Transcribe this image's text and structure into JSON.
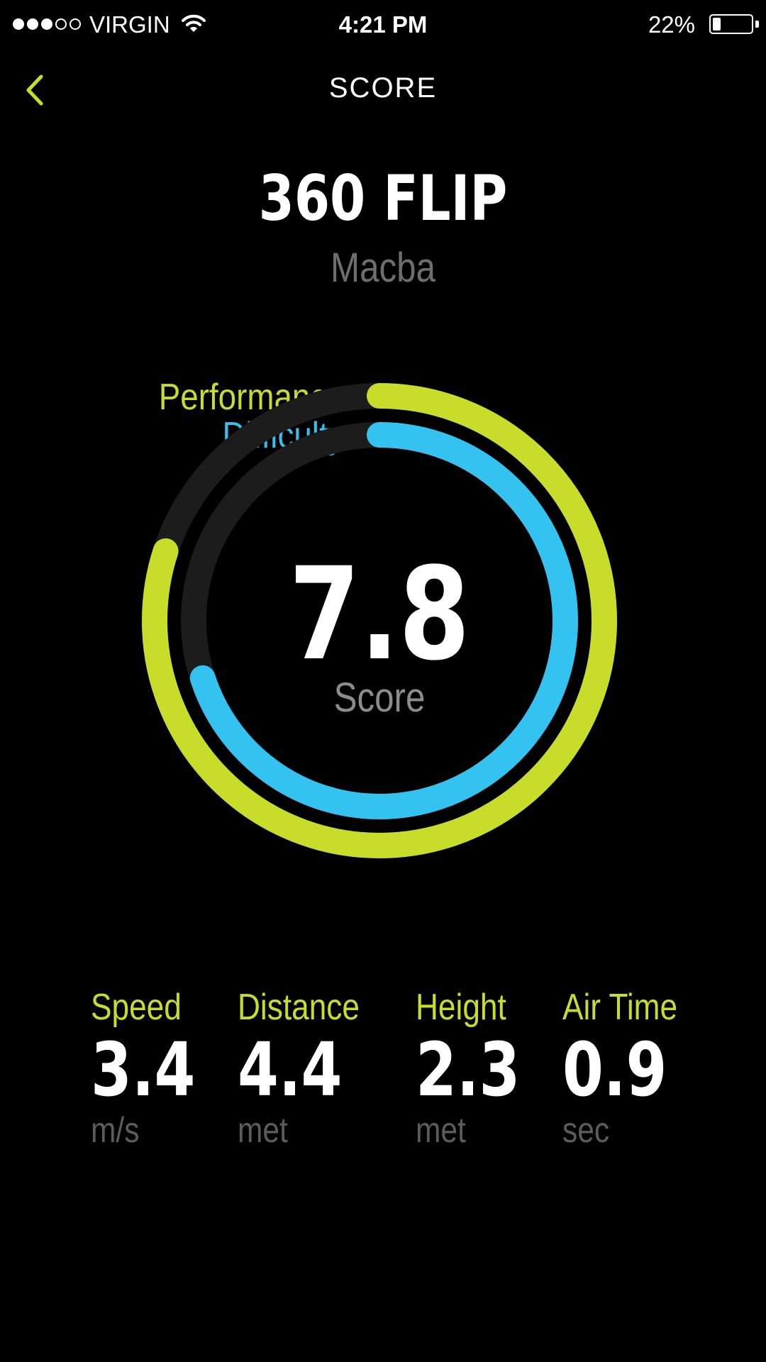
{
  "status_bar": {
    "signal_bars_filled": 3,
    "signal_bars_total": 5,
    "carrier": "VIRGIN",
    "time": "4:21 PM",
    "battery_percent": "22%",
    "battery_level": 0.22
  },
  "nav": {
    "title": "SCORE",
    "back_icon": "chevron-left-icon"
  },
  "trick": {
    "name": "360 FLIP",
    "spot": "Macba"
  },
  "score": {
    "value": "7.8",
    "label": "Score"
  },
  "rings": {
    "performance": {
      "label": "Performance",
      "fraction": 0.8,
      "color": "#c8dc2a"
    },
    "difficulty": {
      "label": "Difficulty",
      "fraction": 0.7,
      "color": "#34c3f0"
    },
    "track_color": "#1c1c1c"
  },
  "stats": [
    {
      "label": "Speed",
      "value": "3.4",
      "unit": "m/s"
    },
    {
      "label": "Distance",
      "value": "4.4",
      "unit": "met"
    },
    {
      "label": "Height",
      "value": "2.3",
      "unit": "met"
    },
    {
      "label": "Air Time",
      "value": "0.9",
      "unit": "sec"
    }
  ],
  "colors": {
    "accent": "#c8dc2a",
    "secondary": "#34c3f0",
    "background": "#000000"
  }
}
